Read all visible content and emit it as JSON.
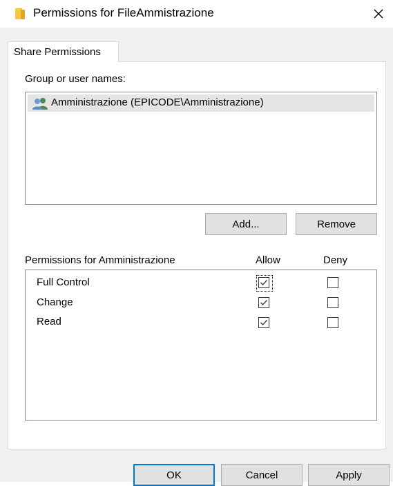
{
  "window": {
    "title": "Permissions for FileAmmistrazione",
    "icon": "folder-icon",
    "close_icon": "close-icon"
  },
  "tabs": [
    {
      "label": "Share Permissions",
      "selected": true
    }
  ],
  "group_section": {
    "label": "Group or user names:",
    "items": [
      {
        "name": "Amministrazione (EPICODE\\Amministrazione)",
        "icon": "user-group-icon",
        "selected": true
      }
    ],
    "add_button": "Add...",
    "remove_button": "Remove"
  },
  "permissions_section": {
    "label": "Permissions for Amministrazione",
    "allow_header": "Allow",
    "deny_header": "Deny",
    "rows": [
      {
        "name": "Full Control",
        "allow": true,
        "deny": false,
        "focused": true
      },
      {
        "name": "Change",
        "allow": true,
        "deny": false
      },
      {
        "name": "Read",
        "allow": true,
        "deny": false
      }
    ]
  },
  "footer": {
    "ok": "OK",
    "cancel": "Cancel",
    "apply": "Apply"
  },
  "colors": {
    "dialog_bg": "#f0f0f0",
    "accent": "#0078d7",
    "selection": "#e5e5e5",
    "folder": "#f8c842",
    "check": "#333333"
  }
}
